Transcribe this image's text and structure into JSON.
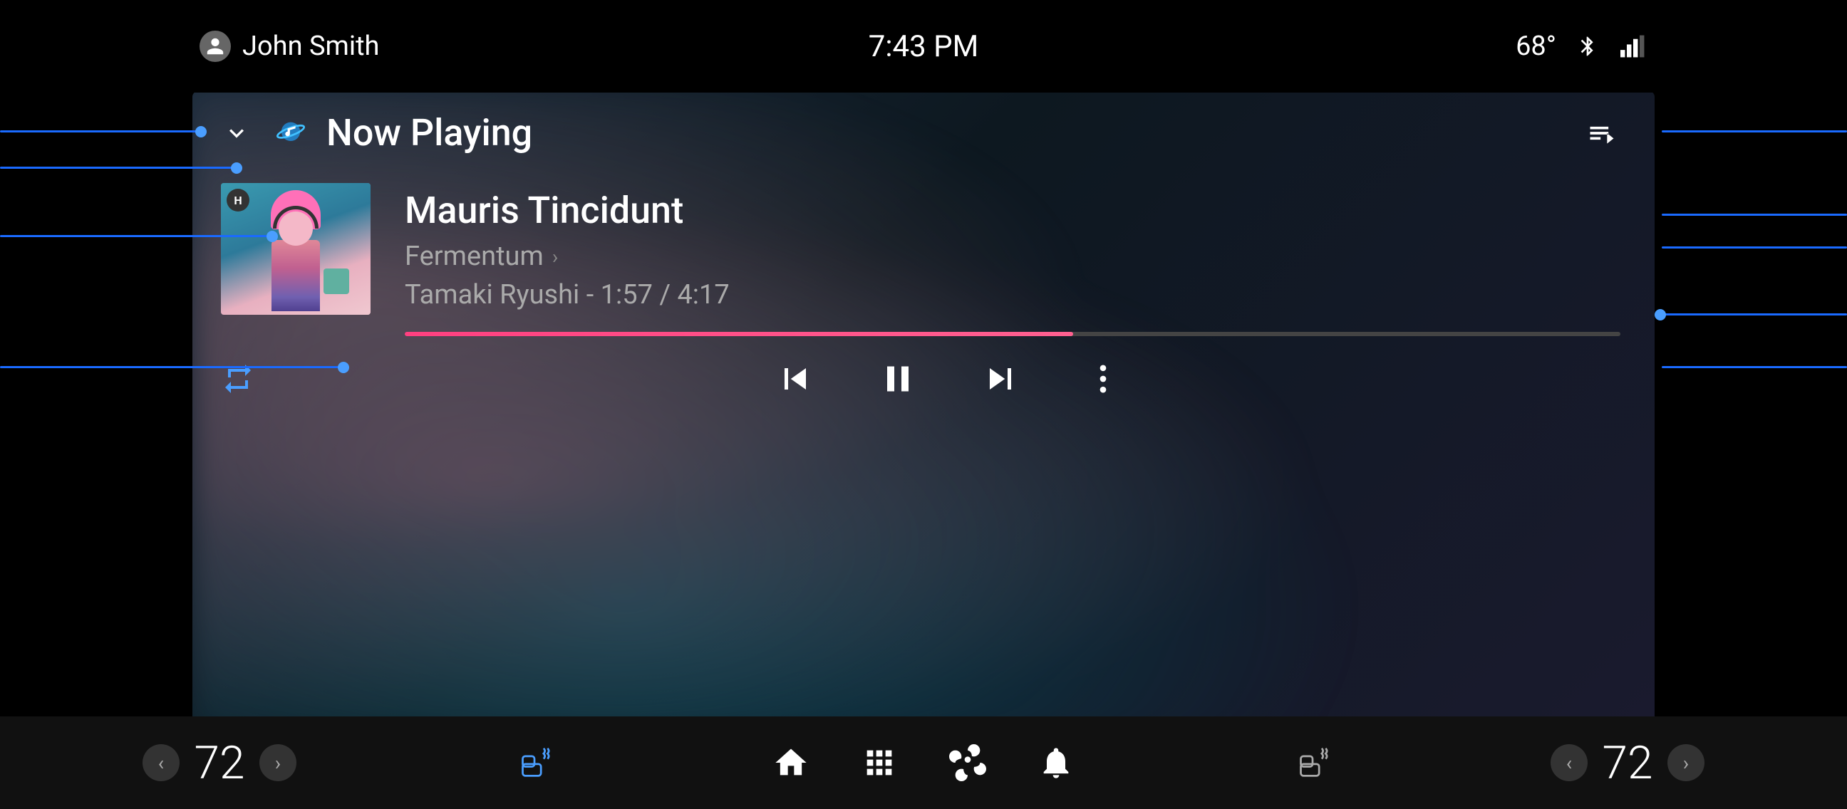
{
  "statusBar": {
    "userName": "John Smith",
    "time": "7:43 PM",
    "temperature": "68°",
    "btLabel": "bluetooth",
    "signalLabel": "signal"
  },
  "header": {
    "chevronLabel": "▾",
    "musicNoteLabel": "♪",
    "title": "Now Playing",
    "queueLabel": "queue"
  },
  "track": {
    "title": "Mauris Tincidunt",
    "album": "Fermentum",
    "artistTime": "Tamaki Ryushi - 1:57 / 4:17",
    "progressPercent": 55
  },
  "controls": {
    "repeatLabel": "repeat",
    "prevLabel": "⏮",
    "pauseLabel": "⏸",
    "nextLabel": "⏭",
    "moreLabel": "⋮"
  },
  "bottomBar": {
    "leftTemp": "72",
    "rightTemp": "72",
    "leftTempArrowLeft": "‹",
    "leftTempArrowRight": "›",
    "rightTempArrowLeft": "‹",
    "rightTempArrowRight": "›",
    "navIcons": [
      "home",
      "apps",
      "fan",
      "notification",
      "left-heat",
      "right-heat"
    ]
  }
}
